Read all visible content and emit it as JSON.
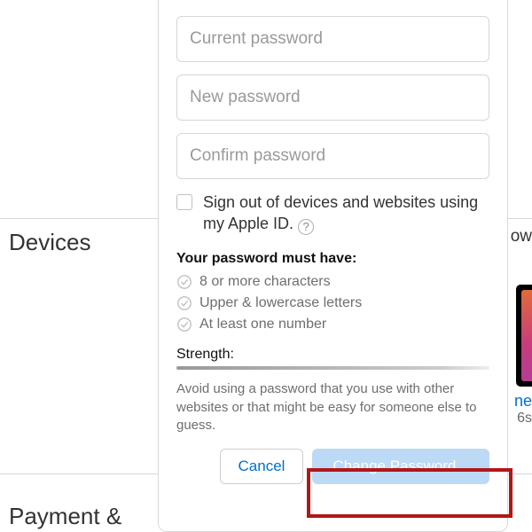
{
  "bg": {
    "devices_label": "Devices",
    "payment_label": "Payment &",
    "right_word_fragment": "ow",
    "phone_line1": "ne",
    "phone_line2": "6s"
  },
  "popover": {
    "fields": {
      "current_placeholder": "Current password",
      "new_placeholder": "New password",
      "confirm_placeholder": "Confirm password"
    },
    "signout_label_1": "Sign out of devices and websites using my Apple ID.",
    "help_glyph": "?",
    "requirements_title": "Your password must have:",
    "requirements": [
      "8 or more characters",
      "Upper & lowercase letters",
      "At least one number"
    ],
    "strength_label": "Strength:",
    "advice": "Avoid using a password that you use with other websites or that might be easy for someone else to guess.",
    "buttons": {
      "cancel": "Cancel",
      "change": "Change Password..."
    }
  }
}
